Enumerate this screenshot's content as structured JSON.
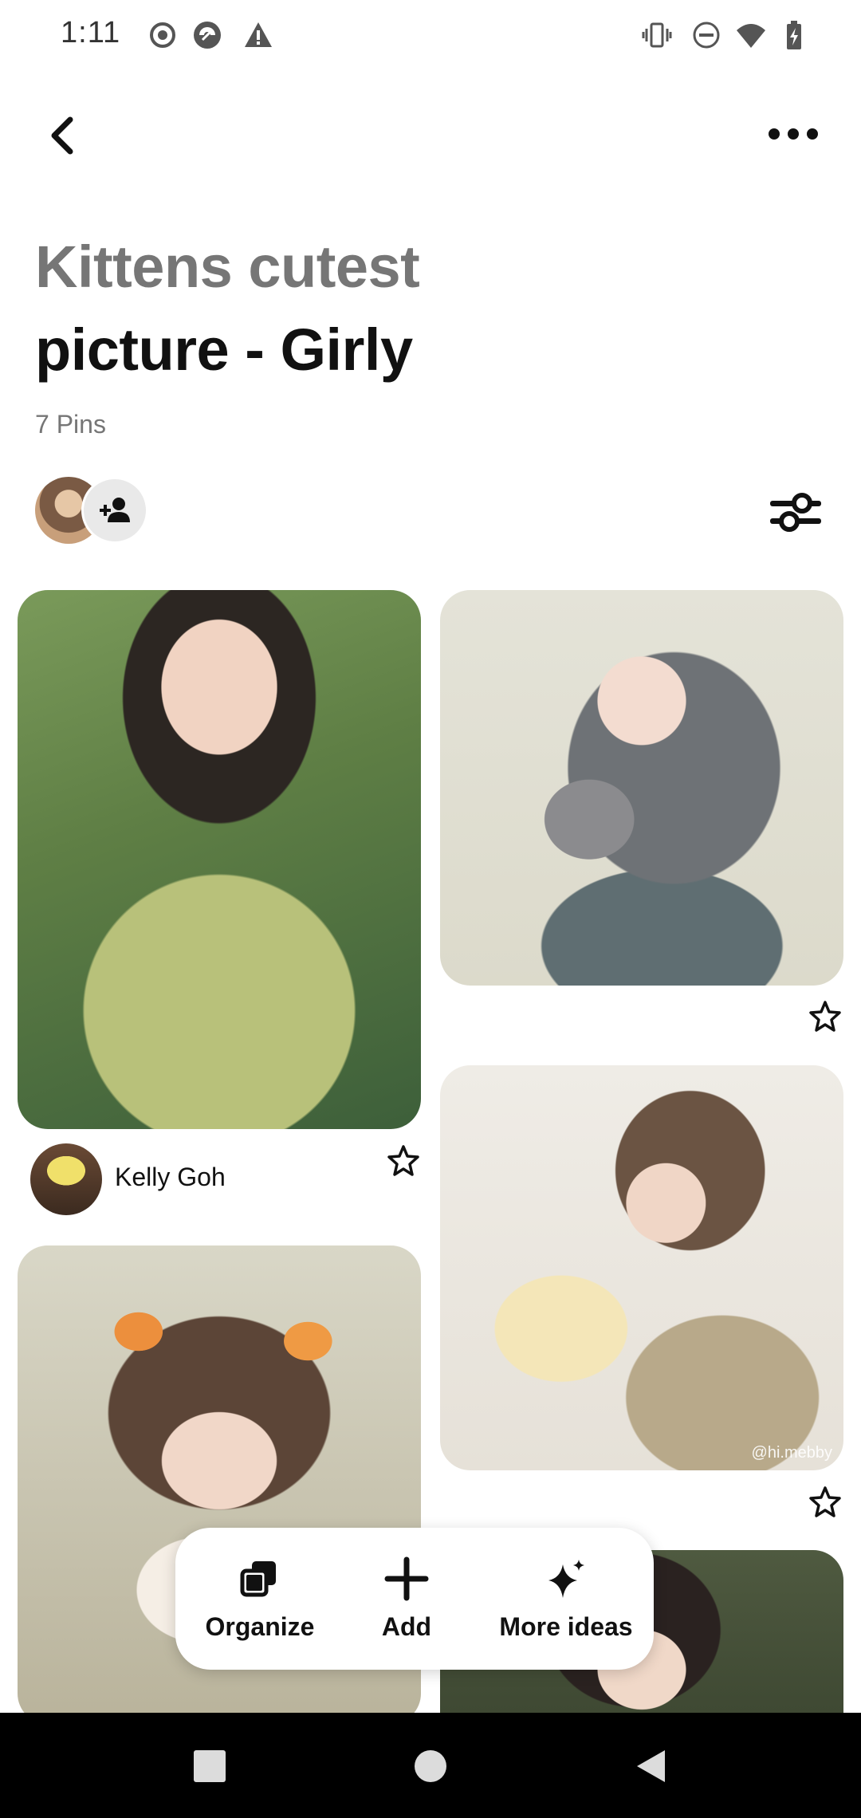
{
  "status_bar": {
    "time": "1:11",
    "left_icons": [
      "record-icon",
      "app-icon",
      "warning-icon"
    ],
    "right_icons": [
      "vibrate-icon",
      "do-not-disturb-icon",
      "wifi-icon",
      "battery-charging-icon"
    ]
  },
  "header": {
    "back_icon": "chevron-left-icon",
    "more_icon": "more-horizontal-icon"
  },
  "board": {
    "title_line1": "Kittens cutest",
    "title_line2": "picture - Girly",
    "pin_count": "7 Pins",
    "collaborator_icon": "add-person-icon",
    "filter_icon": "sliders-icon"
  },
  "pins": [
    {
      "name": "pin-girl-camera",
      "creator": "Kelly Goh"
    },
    {
      "name": "pin-girl-cat"
    },
    {
      "name": "pin-girl-daisies",
      "watermark": "@hi.mebby"
    },
    {
      "name": "pin-girl-flower-crown"
    },
    {
      "name": "pin-girl-dark-hair"
    }
  ],
  "actions": [
    {
      "label": "Organize",
      "icon": "organize-icon"
    },
    {
      "label": "Add",
      "icon": "plus-icon"
    },
    {
      "label": "More ideas",
      "icon": "sparkle-icon"
    }
  ],
  "nav": {
    "buttons": [
      "recents-square-icon",
      "home-circle-icon",
      "back-triangle-icon"
    ]
  },
  "colors": {
    "title_muted": "#767676",
    "text": "#111111",
    "nav_bar": "#000000"
  }
}
